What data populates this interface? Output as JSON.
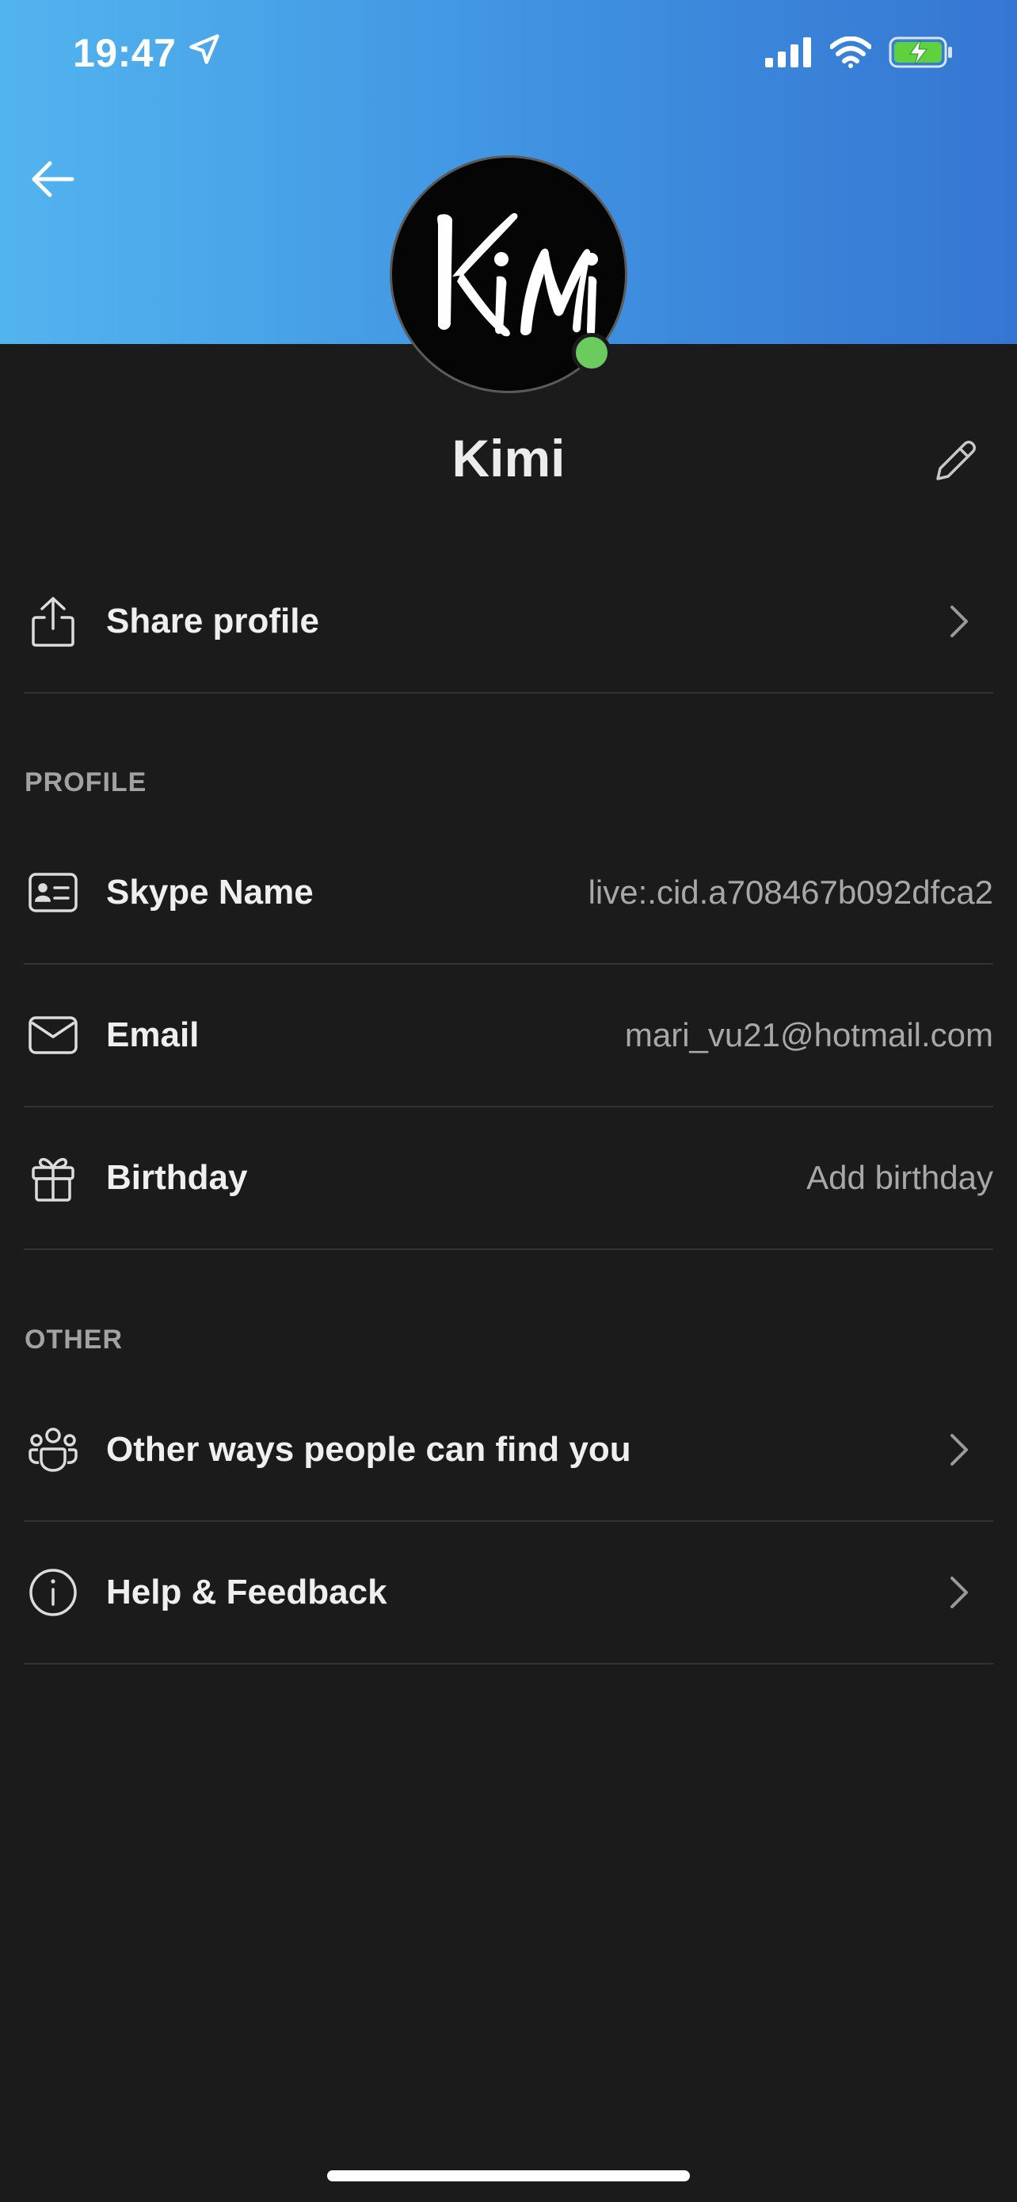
{
  "status_bar": {
    "time": "19:47",
    "icons": [
      "location-arrow-icon",
      "cellular-signal-icon",
      "wifi-icon",
      "battery-charging-icon"
    ]
  },
  "colors": {
    "header_gradient_start": "#52b4ef",
    "header_gradient_end": "#3576d2",
    "background": "#1b1b1b",
    "presence": "#6ccb5f",
    "battery": "#5fd13d"
  },
  "profile": {
    "name": "Kimi",
    "avatar_text": "KiMi",
    "status": "online"
  },
  "share": {
    "label": "Share profile",
    "icon": "share-icon"
  },
  "sections": {
    "profile_title": "PROFILE",
    "other_title": "OTHER"
  },
  "profile_rows": [
    {
      "label": "Skype Name",
      "value": "live:.cid.a708467b092dfca2",
      "icon": "id-card-icon"
    },
    {
      "label": "Email",
      "value": "mari_vu21@hotmail.com",
      "icon": "mail-icon"
    },
    {
      "label": "Birthday",
      "value": "Add birthday",
      "icon": "gift-icon"
    }
  ],
  "other_rows": [
    {
      "label": "Other ways people can find you",
      "icon": "people-group-icon"
    },
    {
      "label": "Help & Feedback",
      "icon": "info-icon"
    }
  ]
}
